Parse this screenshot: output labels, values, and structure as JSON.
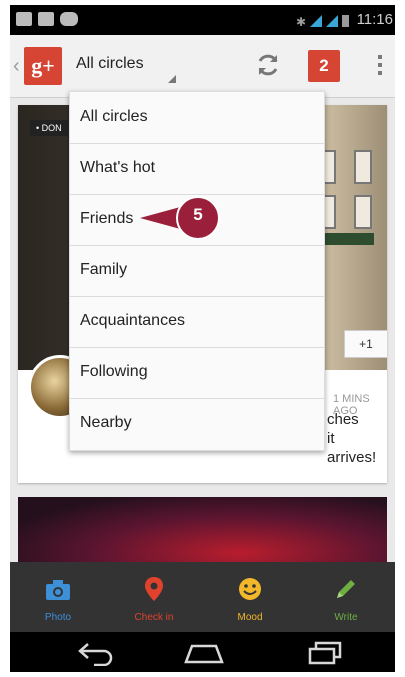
{
  "status_bar": {
    "time": "11:16"
  },
  "action_bar": {
    "logo_text": "g+",
    "circle_selector": "All circles",
    "notification_count": "2"
  },
  "dropdown": {
    "items": [
      "All circles",
      "What's hot",
      "Friends",
      "Family",
      "Acquaintances",
      "Following",
      "Nearby"
    ]
  },
  "callout": {
    "number": "5"
  },
  "feed": {
    "card1": {
      "tag": "• DON",
      "plus_one": "+1",
      "time_ago": "1 MINS AGO",
      "text_line1": "ches",
      "text_line2": "it arrives!"
    }
  },
  "bottom_bar": {
    "items": [
      {
        "label": "Photo",
        "icon": "camera-icon",
        "color": "#3d8fd8"
      },
      {
        "label": "Check in",
        "icon": "location-pin-icon",
        "color": "#e0422d"
      },
      {
        "label": "Mood",
        "icon": "smiley-icon",
        "color": "#f2b72a"
      },
      {
        "label": "Write",
        "icon": "pencil-icon",
        "color": "#6fae40"
      }
    ]
  },
  "colors": {
    "brand_red": "#d64434",
    "callout": "#9a1f3a"
  }
}
